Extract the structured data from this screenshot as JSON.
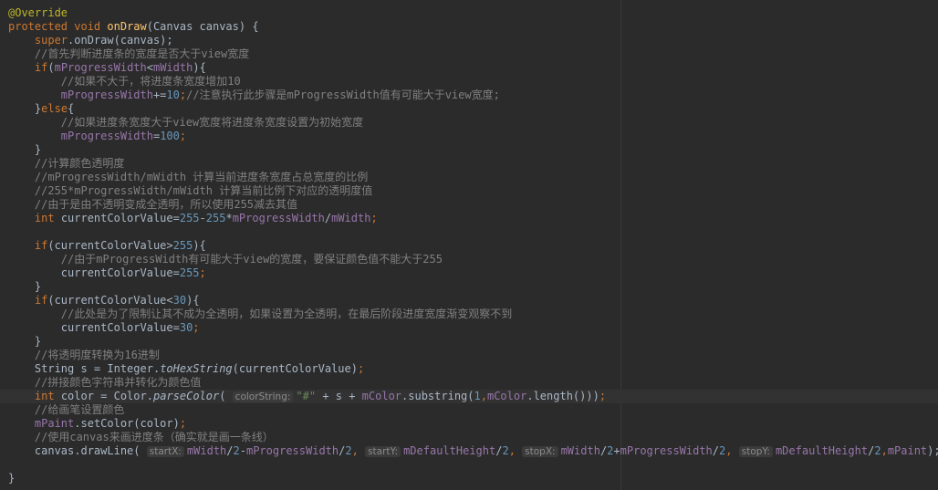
{
  "lines": [
    [
      {
        "t": "@Override",
        "c": "ann"
      }
    ],
    [
      {
        "t": "protected void ",
        "c": "kw"
      },
      {
        "t": "onDraw",
        "c": "fn"
      },
      {
        "t": "(Canvas canvas) {",
        "c": ""
      }
    ],
    [
      {
        "t": "    "
      },
      {
        "t": "super",
        "c": "kw"
      },
      {
        "t": ".onDraw(canvas);",
        "c": ""
      }
    ],
    [
      {
        "t": "    "
      },
      {
        "t": "//首先判断进度条的宽度是否大于view宽度",
        "c": "cm"
      }
    ],
    [
      {
        "t": "    "
      },
      {
        "t": "if",
        "c": "kw"
      },
      {
        "t": "(",
        "c": ""
      },
      {
        "t": "mProgressWidth",
        "c": "fld"
      },
      {
        "t": "<",
        "c": ""
      },
      {
        "t": "mWidth",
        "c": "fld"
      },
      {
        "t": "){",
        "c": ""
      }
    ],
    [
      {
        "t": "        "
      },
      {
        "t": "//如果不大于，将进度条宽度增加10",
        "c": "cm"
      }
    ],
    [
      {
        "t": "        "
      },
      {
        "t": "mProgressWidth",
        "c": "fld"
      },
      {
        "t": "+=",
        "c": ""
      },
      {
        "t": "10",
        "c": "num"
      },
      {
        "t": ";",
        "c": "kw"
      },
      {
        "t": "//注意执行此步骤是mProgressWidth值有可能大于view宽度;",
        "c": "cm"
      }
    ],
    [
      {
        "t": "    "
      },
      {
        "t": "}",
        "c": ""
      },
      {
        "t": "else",
        "c": "kw"
      },
      {
        "t": "{",
        "c": ""
      }
    ],
    [
      {
        "t": "        "
      },
      {
        "t": "//如果进度条宽度大于view宽度将进度条宽度设置为初始宽度",
        "c": "cm"
      }
    ],
    [
      {
        "t": "        "
      },
      {
        "t": "mProgressWidth",
        "c": "fld"
      },
      {
        "t": "=",
        "c": ""
      },
      {
        "t": "100",
        "c": "num"
      },
      {
        "t": ";",
        "c": "kw"
      }
    ],
    [
      {
        "t": "    }"
      }
    ],
    [
      {
        "t": "    "
      },
      {
        "t": "//计算颜色透明度",
        "c": "cm"
      }
    ],
    [
      {
        "t": "    "
      },
      {
        "t": "//mProgressWidth/mWidth 计算当前进度条宽度占总宽度的比例",
        "c": "cm"
      }
    ],
    [
      {
        "t": "    "
      },
      {
        "t": "//255*mProgressWidth/mWidth 计算当前比例下对应的透明度值",
        "c": "cm"
      }
    ],
    [
      {
        "t": "    "
      },
      {
        "t": "//由于是由不透明变成全透明，所以使用255减去其值",
        "c": "cm"
      }
    ],
    [
      {
        "t": "    "
      },
      {
        "t": "int ",
        "c": "kw"
      },
      {
        "t": "currentColorValue=",
        "c": ""
      },
      {
        "t": "255",
        "c": "num"
      },
      {
        "t": "-",
        "c": ""
      },
      {
        "t": "255",
        "c": "num"
      },
      {
        "t": "*",
        "c": ""
      },
      {
        "t": "mProgressWidth",
        "c": "fld"
      },
      {
        "t": "/",
        "c": ""
      },
      {
        "t": "mWidth",
        "c": "fld"
      },
      {
        "t": ";",
        "c": "kw"
      }
    ],
    [],
    [
      {
        "t": "    "
      },
      {
        "t": "if",
        "c": "kw"
      },
      {
        "t": "(currentColorValue>",
        "c": ""
      },
      {
        "t": "255",
        "c": "num"
      },
      {
        "t": "){",
        "c": ""
      }
    ],
    [
      {
        "t": "        "
      },
      {
        "t": "//由于mProgressWidth有可能大于view的宽度，要保证颜色值不能大于255",
        "c": "cm"
      }
    ],
    [
      {
        "t": "        "
      },
      {
        "t": "currentColorValue=",
        "c": ""
      },
      {
        "t": "255",
        "c": "num"
      },
      {
        "t": ";",
        "c": "kw"
      }
    ],
    [
      {
        "t": "    }"
      }
    ],
    [
      {
        "t": "    "
      },
      {
        "t": "if",
        "c": "kw"
      },
      {
        "t": "(currentColorValue<",
        "c": ""
      },
      {
        "t": "30",
        "c": "num"
      },
      {
        "t": "){",
        "c": ""
      }
    ],
    [
      {
        "t": "        "
      },
      {
        "t": "//此处是为了限制让其不成为全透明，如果设置为全透明，在最后阶段进度宽度渐变观察不到",
        "c": "cm"
      }
    ],
    [
      {
        "t": "        "
      },
      {
        "t": "currentColorValue=",
        "c": ""
      },
      {
        "t": "30",
        "c": "num"
      },
      {
        "t": ";",
        "c": "kw"
      }
    ],
    [
      {
        "t": "    }"
      }
    ],
    [
      {
        "t": "    "
      },
      {
        "t": "//将透明度转换为16进制",
        "c": "cm"
      }
    ],
    [
      {
        "t": "    "
      },
      {
        "t": "String s = Integer.",
        "c": ""
      },
      {
        "t": "toHexString",
        "c": "st"
      },
      {
        "t": "(currentColorValue)",
        "c": ""
      },
      {
        "t": ";",
        "c": "kw"
      }
    ],
    [
      {
        "t": "    "
      },
      {
        "t": "//拼接颜色字符串并转化为颜色值",
        "c": "cm"
      }
    ],
    [
      {
        "t": "    "
      },
      {
        "t": "int ",
        "c": "kw"
      },
      {
        "t": "color = Color.",
        "c": ""
      },
      {
        "t": "parseColor",
        "c": "st"
      },
      {
        "t": "( ",
        "c": ""
      },
      {
        "t": "colorString:",
        "c": "hint"
      },
      {
        "t": "\"#\"",
        "c": "str"
      },
      {
        "t": " + s + ",
        "c": ""
      },
      {
        "t": "mColor",
        "c": "fld"
      },
      {
        "t": ".substring(",
        "c": ""
      },
      {
        "t": "1",
        "c": "num"
      },
      {
        "t": ",",
        "c": "kw"
      },
      {
        "t": "mColor",
        "c": "fld"
      },
      {
        "t": ".length()))",
        "c": ""
      },
      {
        "t": ";",
        "c": "kw"
      }
    ],
    [
      {
        "t": "    "
      },
      {
        "t": "//给画笔设置颜色",
        "c": "cm"
      }
    ],
    [
      {
        "t": "    "
      },
      {
        "t": "mPaint",
        "c": "fld"
      },
      {
        "t": ".setColor(color)",
        "c": ""
      },
      {
        "t": ";",
        "c": "kw"
      }
    ],
    [
      {
        "t": "    "
      },
      {
        "t": "//使用canvas来画进度条（确实就是画一条线）",
        "c": "cm"
      }
    ],
    [
      {
        "t": "    "
      },
      {
        "t": "canvas.drawLine( ",
        "c": ""
      },
      {
        "t": "startX:",
        "c": "hint"
      },
      {
        "t": "mWidth",
        "c": "fld"
      },
      {
        "t": "/",
        "c": ""
      },
      {
        "t": "2",
        "c": "num"
      },
      {
        "t": "-",
        "c": ""
      },
      {
        "t": "mProgressWidth",
        "c": "fld"
      },
      {
        "t": "/",
        "c": ""
      },
      {
        "t": "2",
        "c": "num"
      },
      {
        "t": ", ",
        "c": "kw"
      },
      {
        "t": "startY:",
        "c": "hint"
      },
      {
        "t": "mDefaultHeight",
        "c": "fld"
      },
      {
        "t": "/",
        "c": ""
      },
      {
        "t": "2",
        "c": "num"
      },
      {
        "t": ", ",
        "c": "kw"
      },
      {
        "t": "stopX:",
        "c": "hint"
      },
      {
        "t": "mWidth",
        "c": "fld"
      },
      {
        "t": "/",
        "c": ""
      },
      {
        "t": "2",
        "c": "num"
      },
      {
        "t": "+",
        "c": ""
      },
      {
        "t": "mProgressWidth",
        "c": "fld"
      },
      {
        "t": "/",
        "c": ""
      },
      {
        "t": "2",
        "c": "num"
      },
      {
        "t": ", ",
        "c": "kw"
      },
      {
        "t": "stopY:",
        "c": "hint"
      },
      {
        "t": "mDefaultHeight",
        "c": "fld"
      },
      {
        "t": "/",
        "c": ""
      },
      {
        "t": "2",
        "c": "num"
      },
      {
        "t": ",",
        "c": "kw"
      },
      {
        "t": "mPaint",
        "c": "fld"
      },
      {
        "t": ");",
        "c": ""
      }
    ],
    [],
    [
      {
        "t": "}"
      }
    ]
  ],
  "highlighted_line": 28
}
